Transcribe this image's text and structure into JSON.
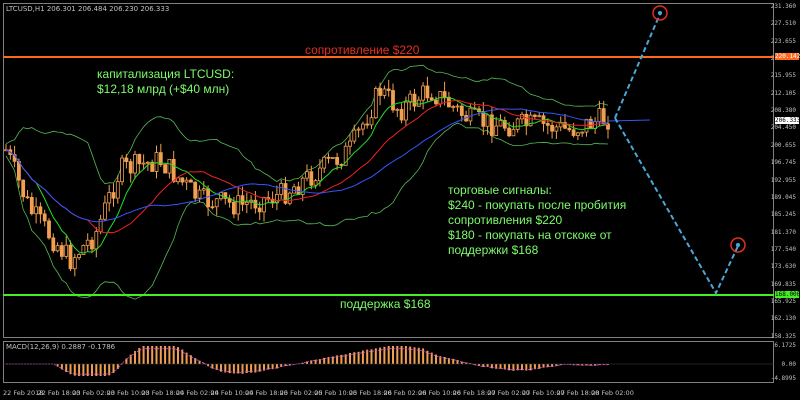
{
  "header": {
    "symbol_info": "LTCUSD,H1  206.301 206.484 206.230 206.333"
  },
  "annotations": {
    "resistance_label": "сопротивление $220",
    "cap_line1": "капитализация LTCUSD:",
    "cap_line2": "$12,18 млрд (+$40 млн)",
    "signals_title": "торговые сигналы:",
    "signal1": "$240 - покупать после пробития",
    "signal1b": "сопротивления $220",
    "signal2": "$180 - покупать на отскоке от",
    "signal2b": "поддержки $168",
    "support_label": "поддержка $168"
  },
  "price_axis": [
    "231.360",
    "227.510",
    "223.655",
    "219.805",
    "215.955",
    "212.105",
    "208.380",
    "204.450",
    "200.655",
    "196.745",
    "192.955",
    "189.045",
    "185.245",
    "181.370",
    "177.540",
    "173.630",
    "169.835",
    "165.925",
    "162.130",
    "158.325"
  ],
  "price_tags": {
    "resistance": "220.142",
    "current": "206.333",
    "support": "168.000"
  },
  "macd": {
    "label": "MACD(12,26,9) 0.2887 -0.1786",
    "axis": [
      "6.1725",
      "0.00",
      "-4.8995"
    ]
  },
  "time_axis": [
    "22 Feb 2018",
    "22 Feb 18:00",
    "23 Feb 02:00",
    "23 Feb 10:00",
    "23 Feb 18:00",
    "24 Feb 02:00",
    "24 Feb 10:00",
    "24 Feb 18:00",
    "25 Feb 02:00",
    "25 Feb 10:00",
    "25 Feb 18:00",
    "26 Feb 02:00",
    "26 Feb 10:00",
    "26 Feb 18:00",
    "27 Feb 02:00",
    "27 Feb 10:00",
    "27 Feb 18:00",
    "28 Feb 02:00"
  ],
  "colors": {
    "background": "#000000",
    "resistance_line": "#ff6a1a",
    "support_line": "#44ee22",
    "candle": "#f0a050",
    "annotation_green": "#7cfc6a",
    "annotation_red": "#e03020",
    "forecast": "#4aa8d8",
    "bollinger": "#55bb55"
  }
}
